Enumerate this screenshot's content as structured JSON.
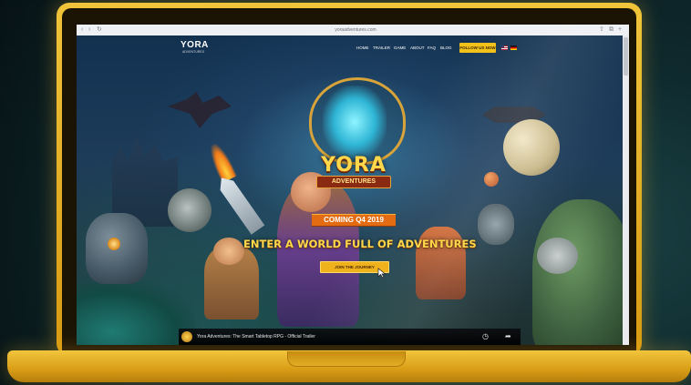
{
  "browser": {
    "url": "yoraadventures.com",
    "back_icon": "chevron-left-icon",
    "forward_icon": "chevron-right-icon",
    "reload_icon": "reload-icon"
  },
  "site": {
    "logo": "YORA",
    "logo_sub": "ADVENTURES",
    "nav": [
      "HOME",
      "TRAILER",
      "GAME",
      "ABOUT",
      "FAQ",
      "BLOG"
    ],
    "follow_label": "FOLLOW US NOW",
    "flags": [
      "us-flag-icon",
      "de-flag-icon"
    ]
  },
  "hero": {
    "logo_main": "YORA",
    "logo_ribbon": "ADVENTURES",
    "coming": "COMING Q4 2019",
    "headline": "ENTER A WORLD FULL OF ADVENTURES",
    "cta_label": "JOIN THE JOURNEY"
  },
  "video": {
    "title": "Yora Adventures: The Smart Tabletop RPG - Official Trailer"
  },
  "colors": {
    "laptop_gold": "#e8b22a",
    "accent_yellow": "#f3c21a",
    "coming_orange": "#e36b12",
    "headline_yellow": "#ffd84a"
  }
}
